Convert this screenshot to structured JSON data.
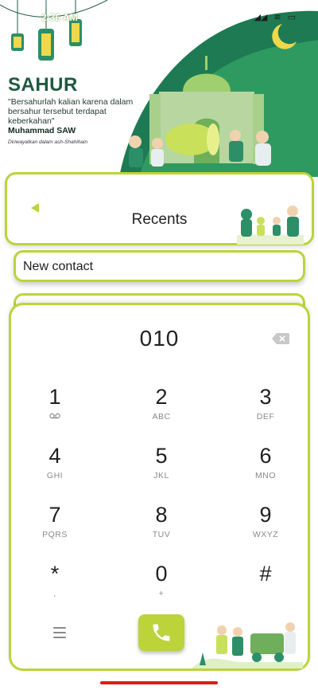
{
  "status_bar": {
    "time": "2:36 AM",
    "icons": [
      "signal-icon",
      "wifi-icon",
      "battery-icon"
    ]
  },
  "banner": {
    "title": "SAHUR",
    "hadith": "\"Bersahurlah kalian karena dalam bersahur tersebut terdapat keberkahan\"",
    "author": "Muhammad SAW",
    "source": "Diriwayatkan dalam ash-Shahihain"
  },
  "recents": {
    "title": "Recents"
  },
  "new_contact": {
    "label": "New contact"
  },
  "dialer": {
    "number": "010",
    "keys": [
      {
        "digit": "1",
        "letters": ""
      },
      {
        "digit": "2",
        "letters": "ABC"
      },
      {
        "digit": "3",
        "letters": "DEF"
      },
      {
        "digit": "4",
        "letters": "GHI"
      },
      {
        "digit": "5",
        "letters": "JKL"
      },
      {
        "digit": "6",
        "letters": "MNO"
      },
      {
        "digit": "7",
        "letters": "PQRS"
      },
      {
        "digit": "8",
        "letters": "TUV"
      },
      {
        "digit": "9",
        "letters": "WXYZ"
      },
      {
        "digit": "*",
        "letters": ","
      },
      {
        "digit": "0",
        "letters": "+"
      },
      {
        "digit": "#",
        "letters": ""
      }
    ]
  },
  "colors": {
    "accent": "#bcd33a",
    "dark_green": "#1f5a40",
    "nav_bar": "#e01b1b"
  }
}
